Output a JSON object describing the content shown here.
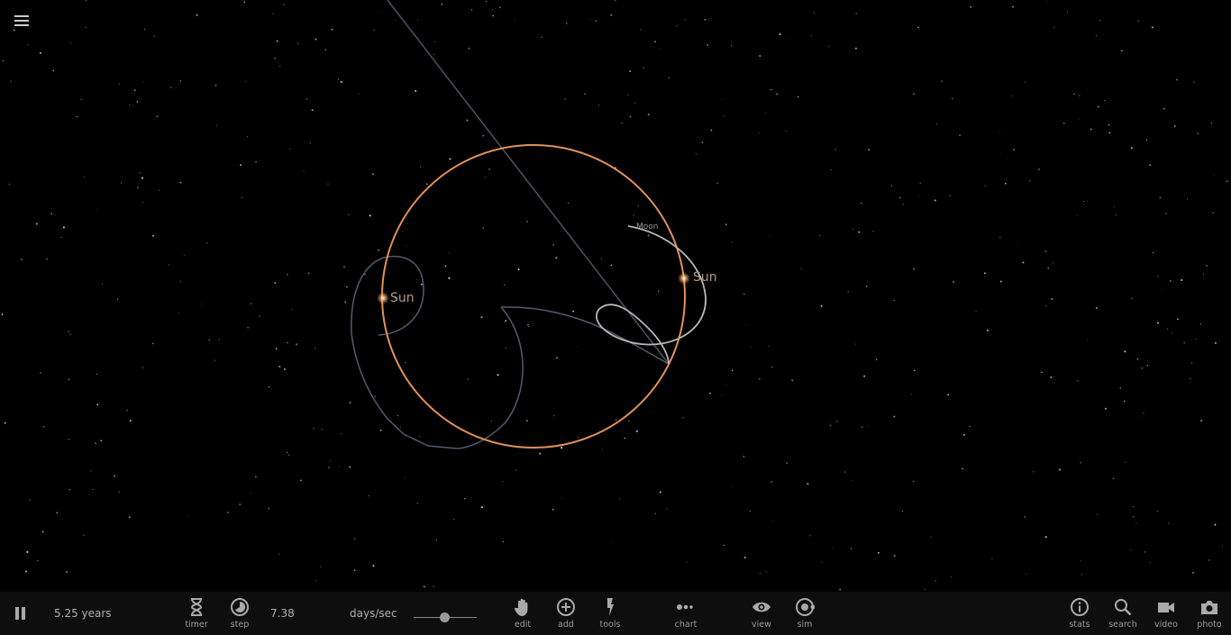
{
  "scene": {
    "bodies": [
      {
        "name": "Sun",
        "label": "Sun"
      },
      {
        "name": "Sun",
        "label": "Sun"
      },
      {
        "name": "Moon",
        "label": "Moon"
      }
    ],
    "colors": {
      "orbit_primary": "#e0925a",
      "orbit_trail": "#5a6a80",
      "moon_trail": "#b8b8b8",
      "background": "#000000"
    }
  },
  "toolbar": {
    "menu_icon": "hamburger-icon",
    "pause_icon": "pause-icon",
    "elapsed": "5.25 years",
    "timer_label": "timer",
    "step_label": "step",
    "speed_value": "7.38",
    "speed_unit": "days/sec",
    "speed_slider_fraction": 0.49,
    "edit_label": "edit",
    "add_label": "add",
    "tools_label": "tools",
    "chart_label": "chart",
    "view_label": "view",
    "sim_label": "sim",
    "stats_label": "stats",
    "search_label": "search",
    "video_label": "video",
    "photo_label": "photo"
  }
}
